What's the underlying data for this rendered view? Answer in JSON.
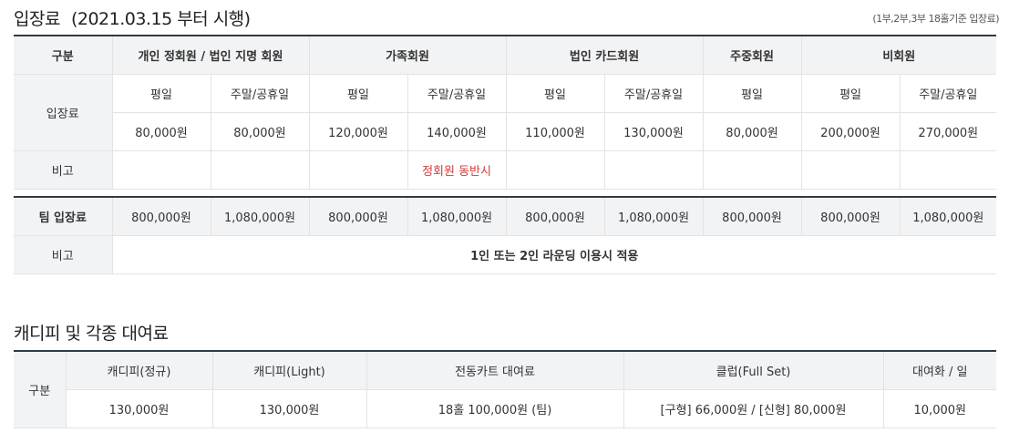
{
  "entry": {
    "title": "입장료",
    "subtitle": "(2021.03.15 부터 시행)",
    "note": "(1부,2부,3부 18홀기준 입장료)",
    "headers": [
      "구분",
      "개인 정회원 / 법인 지명 회원",
      "가족회원",
      "법인 카드회원",
      "주중회원",
      "비회원"
    ],
    "row_label": "입장료",
    "day_types": [
      "평일",
      "주말/공휴일",
      "평일",
      "주말/공휴일",
      "평일",
      "주말/공휴일",
      "평일",
      "평일",
      "주말/공휴일"
    ],
    "fees": [
      "80,000원",
      "80,000원",
      "120,000원",
      "140,000원",
      "110,000원",
      "130,000원",
      "80,000원",
      "200,000원",
      "270,000원"
    ],
    "remark_label": "비고",
    "remark_family": "정회원 동반시",
    "team_label": "팀 입장료",
    "team_fees": [
      "800,000원",
      "1,080,000원",
      "800,000원",
      "1,080,000원",
      "800,000원",
      "1,080,000원",
      "800,000원",
      "800,000원",
      "1,080,000원"
    ],
    "team_remark_label": "비고",
    "team_remark": "1인 또는 2인 라운딩 이용시 적용"
  },
  "rental": {
    "title": "캐디피 및 각종 대여료",
    "row_label": "구분",
    "headers": [
      "캐디피(정규)",
      "캐디피(Light)",
      "전동카트 대여료",
      "클럽(Full Set)",
      "대여화 / 일"
    ],
    "values": [
      "130,000원",
      "130,000원",
      "18홀 100,000원 (팀)",
      "[구형] 66,000원 / [신형] 80,000원",
      "10,000원"
    ]
  }
}
